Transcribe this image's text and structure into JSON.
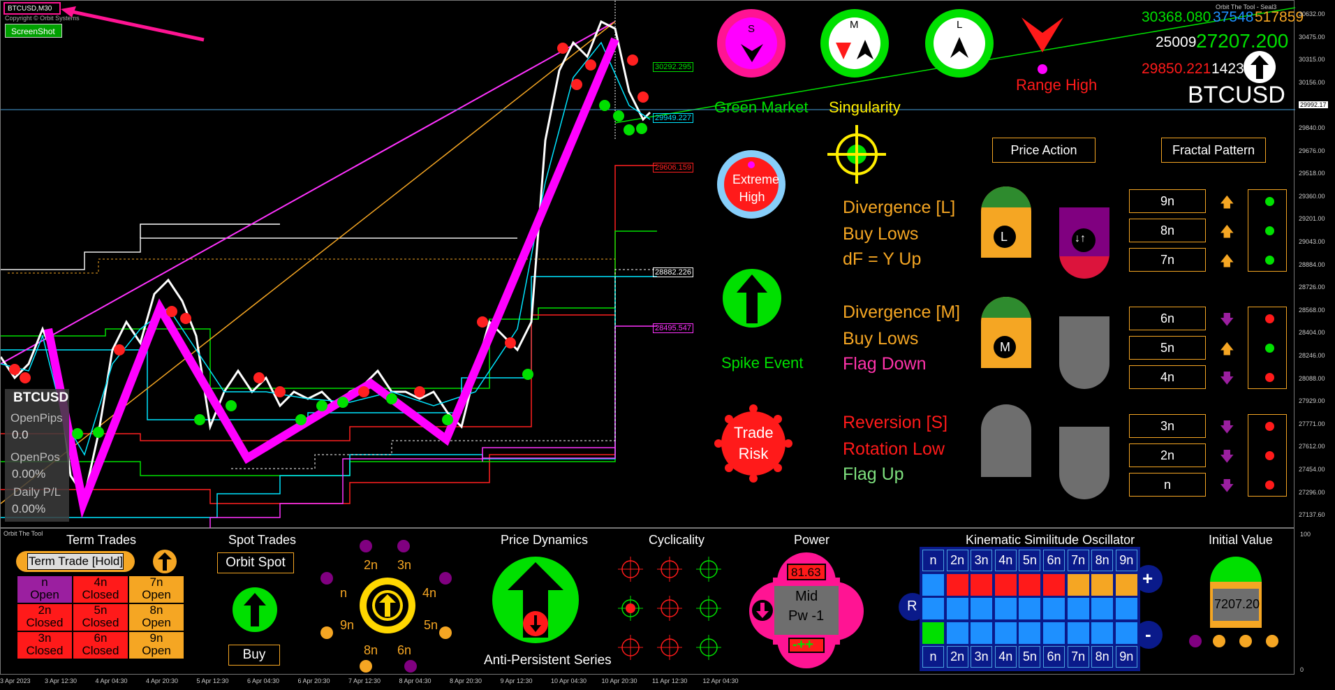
{
  "chart_header": {
    "symbol_tf": "BTCUSD,M30",
    "copyright": "Copyright © Orbit Systems",
    "screenshot_btn": "ScreenShot",
    "indicator_name": "Orbit The Tool - Seal3"
  },
  "price_axis": [
    "30632.00",
    "30475.00",
    "30315.00",
    "30156.00",
    "29992.17",
    "29840.00",
    "29676.00",
    "29518.00",
    "29360.00",
    "29201.00",
    "29043.00",
    "28884.00",
    "28726.00",
    "28568.00",
    "28404.00",
    "28246.00",
    "28088.00",
    "27929.00",
    "27771.00",
    "27612.00",
    "27454.00",
    "27296.00",
    "27137.60"
  ],
  "current_price": "29992.17",
  "time_axis": [
    "3 Apr 2023",
    "3 Apr 12:30",
    "4 Apr 04:30",
    "4 Apr 20:30",
    "5 Apr 12:30",
    "6 Apr 04:30",
    "6 Apr 20:30",
    "7 Apr 12:30",
    "8 Apr 04:30",
    "8 Apr 20:30",
    "9 Apr 12:30",
    "10 Apr 04:30",
    "10 Apr 20:30",
    "11 Apr 12:30",
    "12 Apr 04:30"
  ],
  "level_labels": [
    {
      "text": "30292.295",
      "color": "#00e000"
    },
    {
      "text": "29949.227",
      "color": "#00e5ff"
    },
    {
      "text": "29606.159",
      "color": "#ff2020"
    },
    {
      "text": "28882.226",
      "color": "#ffffff"
    },
    {
      "text": "28495.547",
      "color": "#ff33ff"
    }
  ],
  "info": {
    "symbol": "BTCUSD",
    "open_pips_label": "OpenPips",
    "open_pips": "0.0",
    "open_pos_label": "OpenPos",
    "open_pos": "0.00%",
    "daily_label": "Daily P/L",
    "daily": "0.00%"
  },
  "top_right": {
    "v1": "30368.080",
    "v2": "37548",
    "v3": "517859",
    "v4": "25009",
    "v5": "27207.200",
    "v6": "29850.221",
    "v7": "142379",
    "symbol": "BTCUSD"
  },
  "dials": {
    "s": "S",
    "m": "M",
    "l": "L",
    "range_high": "Range High",
    "green_market": "Green Market",
    "singularity": "Singularity"
  },
  "extreme": "Extreme High",
  "spike": "Spike Event",
  "trade_risk": "Trade Risk",
  "headers": {
    "price_action": "Price Action",
    "fractal_pattern": "Fractal Pattern"
  },
  "signals": [
    {
      "lines": [
        {
          "t": "Divergence [L]",
          "c": "#f5a623"
        },
        {
          "t": "Buy Lows",
          "c": "#f5a623"
        },
        {
          "t": "dF = Y Up",
          "c": "#f5a623"
        }
      ],
      "badge": "L"
    },
    {
      "lines": [
        {
          "t": "Divergence [M]",
          "c": "#f5a623"
        },
        {
          "t": "Buy Lows",
          "c": "#f5a623"
        },
        {
          "t": "Flag Down",
          "c": "#ff33aa"
        }
      ],
      "badge": "M"
    },
    {
      "lines": [
        {
          "t": "Reversion [S]",
          "c": "#ff2020"
        },
        {
          "t": "Rotation Low",
          "c": "#ff2020"
        },
        {
          "t": "Flag Up",
          "c": "#7ee07e"
        }
      ],
      "badge": ""
    }
  ],
  "fractal_rows": [
    {
      "label": "9n",
      "dir": "up",
      "dot": "#00e000"
    },
    {
      "label": "8n",
      "dir": "up",
      "dot": "#00e000"
    },
    {
      "label": "7n",
      "dir": "up",
      "dot": "#00e000"
    },
    {
      "label": "6n",
      "dir": "down",
      "dot": "#ff1a1a"
    },
    {
      "label": "5n",
      "dir": "up",
      "dot": "#00e000"
    },
    {
      "label": "4n",
      "dir": "down",
      "dot": "#ff1a1a"
    },
    {
      "label": "3n",
      "dir": "down",
      "dot": "#ff1a1a"
    },
    {
      "label": "2n",
      "dir": "down",
      "dot": "#ff1a1a"
    },
    {
      "label": "n",
      "dir": "down",
      "dot": "#ff1a1a"
    }
  ],
  "bottom": {
    "orbit_label": "Orbit The Tool",
    "term_title": "Term Trades",
    "term_btn": "Term Trade [Hold]",
    "term_cells": [
      {
        "a": "n",
        "b": "Open",
        "bg": "#9b1fa0"
      },
      {
        "a": "4n",
        "b": "Closed",
        "bg": "#ff1a1a"
      },
      {
        "a": "7n",
        "b": "Open",
        "bg": "#f5a623"
      },
      {
        "a": "2n",
        "b": "Closed",
        "bg": "#ff1a1a"
      },
      {
        "a": "5n",
        "b": "Closed",
        "bg": "#ff1a1a"
      },
      {
        "a": "8n",
        "b": "Open",
        "bg": "#f5a623"
      },
      {
        "a": "3n",
        "b": "Closed",
        "bg": "#ff1a1a"
      },
      {
        "a": "6n",
        "b": "Closed",
        "bg": "#ff1a1a"
      },
      {
        "a": "9n",
        "b": "Open",
        "bg": "#f5a623"
      }
    ],
    "spot_title": "Spot Trades",
    "spot_btn": "Orbit Spot",
    "buy": "Buy",
    "orbit_nodes": [
      "2n",
      "3n",
      "n",
      "4n",
      "9n",
      "5n",
      "8n",
      "6n"
    ],
    "price_dyn_title": "Price Dynamics",
    "anti": "Anti-Persistent Series",
    "cyc_title": "Cyclicality",
    "power_title": "Power",
    "power_val": "81.63",
    "power_mid": "Mid",
    "power_pw": "Pw -1",
    "power_sig": "-++",
    "kso_title": "Kinematic Similitude Oscillator",
    "kso_labels": [
      "n",
      "2n",
      "3n",
      "4n",
      "5n",
      "6n",
      "7n",
      "8n",
      "9n"
    ],
    "kso_row1": [
      "#1e90ff",
      "#ff1a1a",
      "#ff1a1a",
      "#ff1a1a",
      "#ff1a1a",
      "#ff1a1a",
      "#f5a623",
      "#f5a623",
      "#f5a623"
    ],
    "kso_row2": [
      "#1e90ff",
      "#1e90ff",
      "#1e90ff",
      "#1e90ff",
      "#1e90ff",
      "#1e90ff",
      "#1e90ff",
      "#1e90ff",
      "#1e90ff"
    ],
    "kso_row3": [
      "#00e000",
      "#1e90ff",
      "#1e90ff",
      "#1e90ff",
      "#1e90ff",
      "#1e90ff",
      "#1e90ff",
      "#1e90ff",
      "#1e90ff"
    ],
    "kso_r": "R",
    "kso_plus": "+",
    "kso_minus": "-",
    "init_title": "Initial Value",
    "init_val": "7207.20"
  },
  "sub_axis": [
    "100",
    "0"
  ]
}
